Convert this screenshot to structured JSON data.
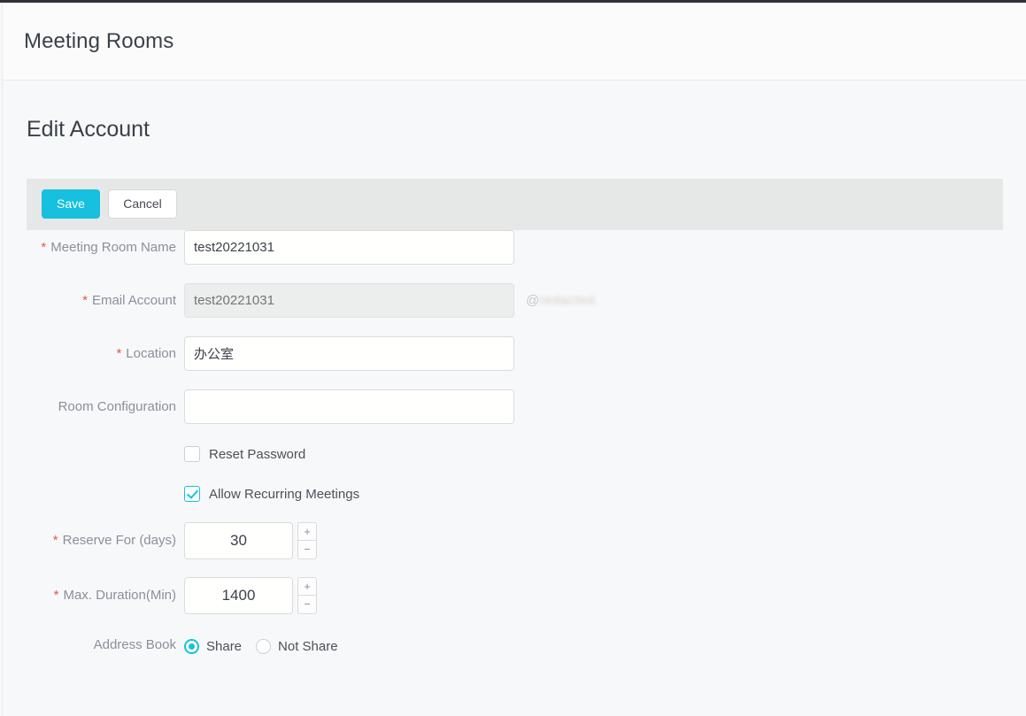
{
  "app": {
    "header_title": "Meeting Rooms",
    "section_title": "Edit Account"
  },
  "toolbar": {
    "save_label": "Save",
    "cancel_label": "Cancel",
    "accent_color": "#16c0de",
    "background_color": "#e6e8e8"
  },
  "form": {
    "required_marker": "*",
    "fields": [
      {
        "label": "Meeting Room Name",
        "required": true,
        "value": "test20221031",
        "placeholder": "",
        "disabled": false
      },
      {
        "label": "Email Account",
        "required": true,
        "value": "",
        "placeholder": "test20221031",
        "disabled": true,
        "suffix_at": "@",
        "suffix_domain": "redacted."
      },
      {
        "label": "Location",
        "required": true,
        "value": "办公室",
        "placeholder": "",
        "disabled": false
      },
      {
        "label": "Room Configuration",
        "required": false,
        "value": "",
        "placeholder": "",
        "disabled": false
      }
    ],
    "checkboxes": [
      {
        "label": "Reset Password",
        "checked": false
      },
      {
        "label": "Allow Recurring Meetings",
        "checked": true
      }
    ],
    "steppers": [
      {
        "label": "Reserve For (days)",
        "required": true,
        "value": "30",
        "increment_label": "+",
        "decrement_label": "−"
      },
      {
        "label": "Max. Duration(Min)",
        "required": true,
        "value": "1400",
        "increment_label": "+",
        "decrement_label": "−"
      }
    ],
    "radio_group": {
      "label": "Address Book",
      "required": false,
      "options": [
        {
          "label": "Share",
          "selected": true
        },
        {
          "label": "Not Share",
          "selected": false
        }
      ]
    }
  }
}
